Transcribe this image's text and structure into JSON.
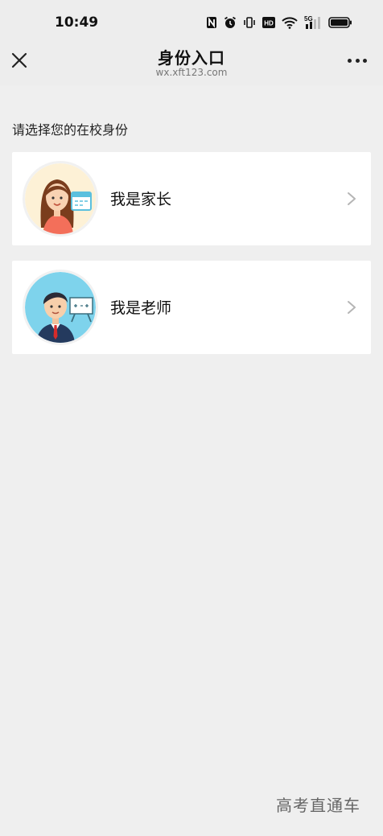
{
  "status_bar": {
    "time": "10:49",
    "icons": [
      "nfc-icon",
      "alarm-icon",
      "vibrate-icon",
      "hd-icon",
      "wifi-icon",
      "signal-5g-icon",
      "battery-icon"
    ],
    "hd_text": "HD",
    "network_text": "5G"
  },
  "nav": {
    "title": "身份入口",
    "url": "wx.xft123.com"
  },
  "main": {
    "prompt": "请选择您的在校身份",
    "options": [
      {
        "label": "我是家长",
        "icon": "parent-avatar-icon"
      },
      {
        "label": "我是老师",
        "icon": "teacher-avatar-icon"
      }
    ]
  },
  "footer": {
    "watermark": "高考直通车"
  },
  "colors": {
    "background": "#efefef",
    "card": "#ffffff",
    "nav_background": "#ededed"
  }
}
